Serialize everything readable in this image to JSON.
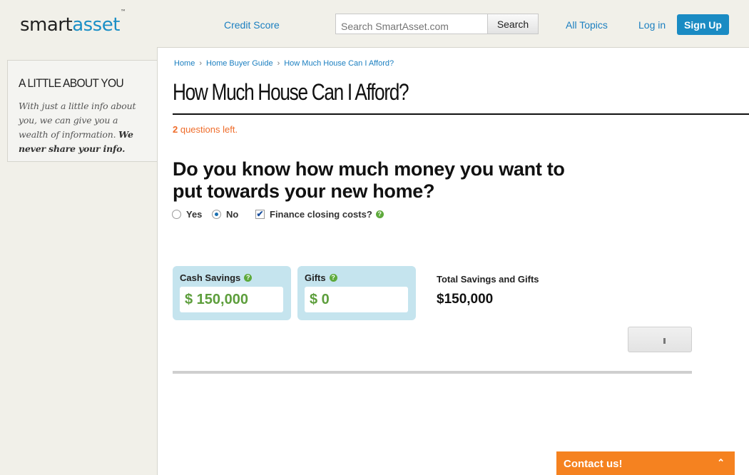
{
  "header": {
    "logo_left": "smart",
    "logo_right": "asset",
    "logo_tm": "™",
    "credit_score": "Credit Score",
    "search_placeholder": "Search SmartAsset.com",
    "search_button": "Search",
    "all_topics": "All Topics",
    "log_in": "Log in",
    "sign_up": "Sign Up"
  },
  "sidebar": {
    "title": "A LITTLE ABOUT YOU",
    "text": "With just a little info about you, we can give you a wealth of information.",
    "text_bold": "We never share your info."
  },
  "breadcrumb": {
    "items": [
      "Home",
      "Home Buyer Guide",
      "How Much House Can I Afford?"
    ]
  },
  "page": {
    "title": "How Much House Can I Afford?",
    "questions_count": "2",
    "questions_text": " questions left.",
    "question": "Do you know how much money you want to put towards your new home?"
  },
  "options": {
    "yes": "Yes",
    "no": "No",
    "selected": "No",
    "finance": "Finance closing costs?",
    "finance_checked": true
  },
  "inputs": {
    "cash_label": "Cash Savings",
    "cash_value": "$ 150,000",
    "gifts_label": "Gifts",
    "gifts_value": "$ 0"
  },
  "totals": {
    "label": "Total Savings and Gifts",
    "value": "$150,000"
  },
  "contact": {
    "label": "Contact us!"
  },
  "colors": {
    "brand_blue": "#1a8bc3",
    "orange": "#f58220",
    "green": "#5d9e3c",
    "card_blue": "#c5e4ee"
  },
  "icons": {
    "help": "question-circle-icon",
    "breadcrumb_sep": "chevron-right-icon",
    "contact": "chevron-up-icon"
  }
}
